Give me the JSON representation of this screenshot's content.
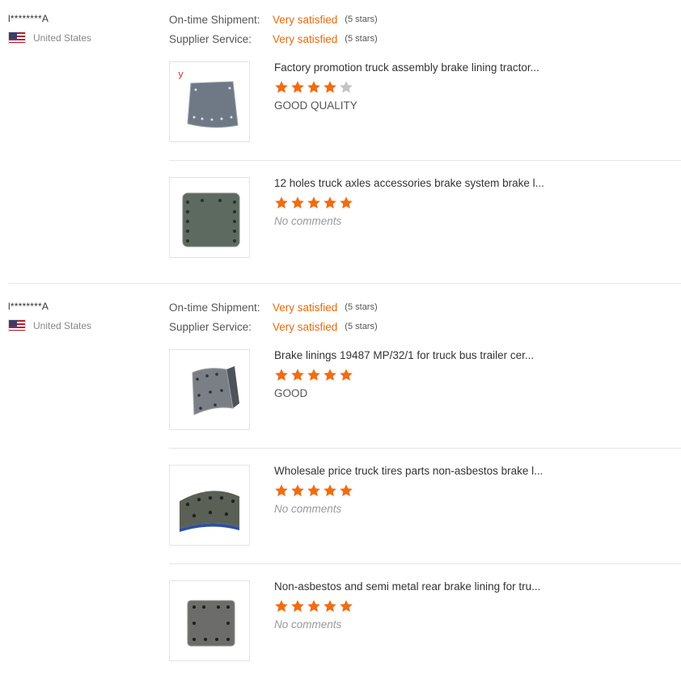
{
  "colors": {
    "accent": "#e86a0c",
    "star_filled": "#f26b11",
    "star_empty": "#c4c4c4"
  },
  "reviews": [
    {
      "user": "l********A",
      "country": "United States",
      "flag_icon": "us-flag-icon",
      "ratings": [
        {
          "label": "On-time Shipment:",
          "value": "Very satisfied",
          "stars": "(5 stars)"
        },
        {
          "label": "Supplier Service:",
          "value": "Very satisfied",
          "stars": "(5 stars)"
        }
      ],
      "products": [
        {
          "title": "Factory promotion truck assembly brake lining tractor...",
          "rating": 4,
          "comment": "GOOD QUALITY"
        },
        {
          "title": "12 holes truck axles accessories brake system brake l...",
          "rating": 5,
          "comment": "No comments"
        }
      ]
    },
    {
      "user": "l********A",
      "country": "United States",
      "flag_icon": "us-flag-icon",
      "ratings": [
        {
          "label": "On-time Shipment:",
          "value": "Very satisfied",
          "stars": "(5 stars)"
        },
        {
          "label": "Supplier Service:",
          "value": "Very satisfied",
          "stars": "(5 stars)"
        }
      ],
      "products": [
        {
          "title": "Brake linings 19487 MP/32/1 for truck bus trailer cer...",
          "rating": 5,
          "comment": "GOOD"
        },
        {
          "title": "Wholesale price truck tires parts non-asbestos brake l...",
          "rating": 5,
          "comment": "No comments"
        },
        {
          "title": "Non-asbestos and semi metal rear brake lining for tru...",
          "rating": 5,
          "comment": "No comments"
        }
      ]
    }
  ]
}
